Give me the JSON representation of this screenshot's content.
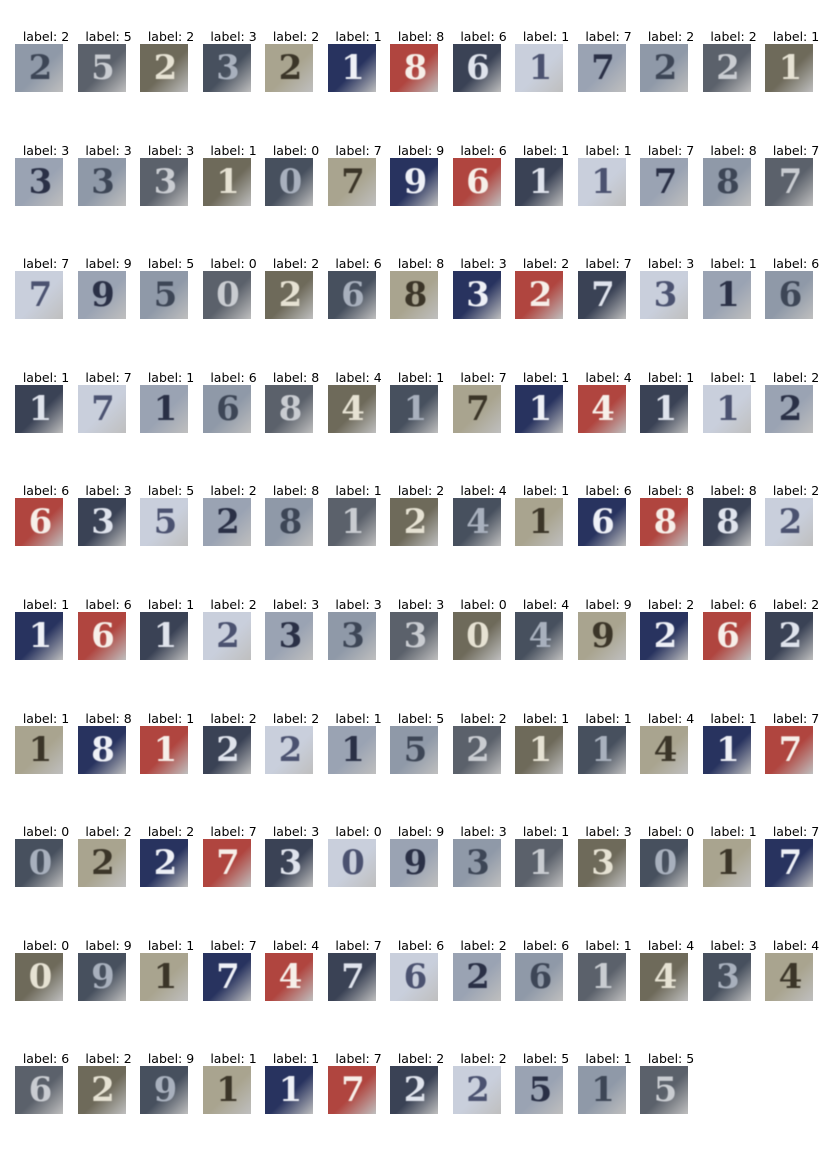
{
  "label_prefix": "label: ",
  "rows": [
    {
      "labels": [
        2,
        5,
        2,
        3,
        2,
        1,
        8,
        6,
        1,
        7,
        2,
        2,
        1
      ]
    },
    {
      "labels": [
        3,
        3,
        3,
        1,
        0,
        7,
        9,
        6,
        1,
        1,
        7,
        8,
        7
      ]
    },
    {
      "labels": [
        7,
        9,
        5,
        0,
        2,
        6,
        8,
        3,
        2,
        7,
        3,
        1,
        6
      ]
    },
    {
      "labels": [
        1,
        7,
        1,
        6,
        8,
        4,
        1,
        7,
        1,
        4,
        1,
        1,
        2
      ]
    },
    {
      "labels": [
        6,
        3,
        5,
        2,
        8,
        1,
        2,
        4,
        1,
        6,
        8,
        8,
        2
      ]
    },
    {
      "labels": [
        1,
        6,
        1,
        2,
        3,
        3,
        3,
        0,
        4,
        9,
        2,
        6,
        2
      ]
    },
    {
      "labels": [
        1,
        8,
        1,
        2,
        2,
        1,
        5,
        2,
        1,
        1,
        4,
        1,
        7
      ]
    },
    {
      "labels": [
        0,
        2,
        2,
        7,
        3,
        0,
        9,
        3,
        1,
        3,
        0,
        1,
        7
      ]
    },
    {
      "labels": [
        0,
        9,
        1,
        7,
        4,
        7,
        6,
        2,
        6,
        1,
        4,
        3,
        4
      ]
    },
    {
      "labels": [
        6,
        2,
        9,
        1,
        1,
        7,
        2,
        2,
        5,
        1,
        5
      ]
    }
  ],
  "palette": [
    {
      "bg": "#8f99a8",
      "fg": "#3d4656"
    },
    {
      "bg": "#3a4255",
      "fg": "#dfe3ec"
    },
    {
      "bg": "#a9a48f",
      "fg": "#3b3528"
    },
    {
      "bg": "#5b616b",
      "fg": "#c9ccd1"
    },
    {
      "bg": "#c9cfdc",
      "fg": "#4b5270"
    },
    {
      "bg": "#28335f",
      "fg": "#eef0f6"
    },
    {
      "bg": "#6e6a5a",
      "fg": "#e6e2d3"
    },
    {
      "bg": "#9aa3b3",
      "fg": "#2a3046"
    },
    {
      "bg": "#b0453f",
      "fg": "#f6efe9"
    },
    {
      "bg": "#47505e",
      "fg": "#a8b0bd"
    }
  ]
}
